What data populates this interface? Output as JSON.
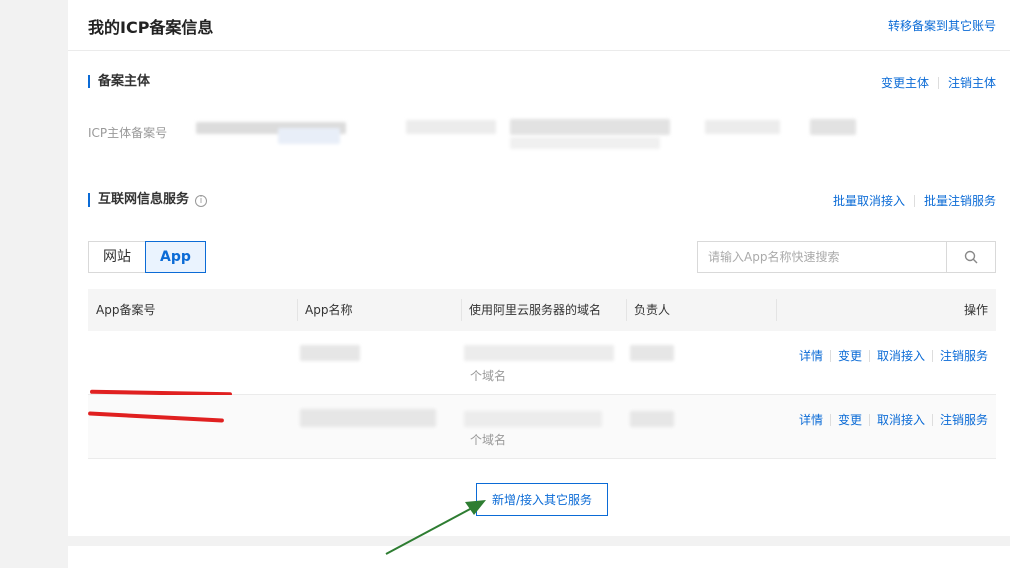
{
  "header": {
    "title": "我的ICP备案信息",
    "transfer_link": "转移备案到其它账号"
  },
  "subject_section": {
    "title": "备案主体",
    "actions": [
      "变更主体",
      "注销主体"
    ],
    "field_label": "ICP主体备案号"
  },
  "service_section": {
    "title": "互联网信息服务",
    "actions": [
      "批量取消接入",
      "批量注销服务"
    ]
  },
  "tabs": [
    {
      "label": "网站",
      "active": false
    },
    {
      "label": "App",
      "active": true
    }
  ],
  "search": {
    "placeholder": "请输入App名称快速搜索"
  },
  "table": {
    "columns": [
      "App备案号",
      "App名称",
      "使用阿里云服务器的域名",
      "负责人",
      "操作"
    ],
    "rows": [
      {
        "domain_note": "个域名",
        "ops": [
          "详情",
          "变更",
          "取消接入",
          "注销服务"
        ]
      },
      {
        "domain_note": "个域名",
        "ops": [
          "详情",
          "变更",
          "取消接入",
          "注销服务"
        ]
      }
    ]
  },
  "add_button": "新增/接入其它服务",
  "colors": {
    "accent": "#0b6bd6",
    "annotation_red": "#e02020",
    "annotation_arrow": "#2e7d32"
  }
}
